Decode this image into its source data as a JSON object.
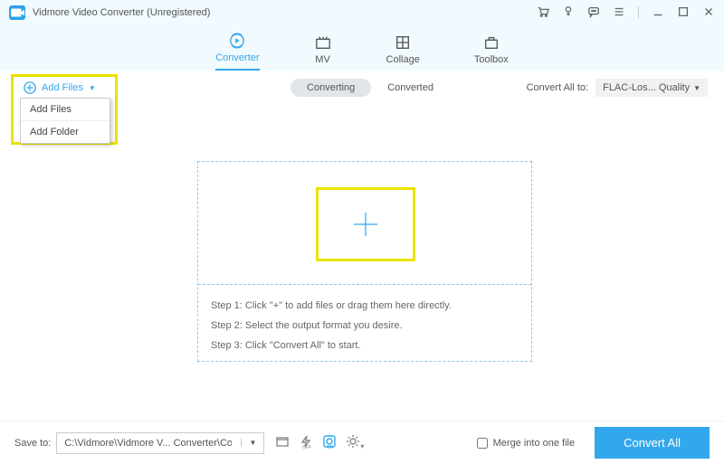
{
  "titlebar": {
    "title": "Vidmore Video Converter (Unregistered)"
  },
  "nav": {
    "tabs": [
      {
        "label": "Converter",
        "active": true
      },
      {
        "label": "MV"
      },
      {
        "label": "Collage"
      },
      {
        "label": "Toolbox"
      }
    ]
  },
  "subbar": {
    "add_files_label": "Add Files",
    "dropdown": [
      {
        "label": "Add Files"
      },
      {
        "label": "Add Folder"
      }
    ],
    "converting_label": "Converting",
    "converted_label": "Converted",
    "convert_all_label": "Convert All to:",
    "format_selected": "FLAC-Los... Quality"
  },
  "dropzone": {
    "step1": "Step 1: Click \"+\" to add files or drag them here directly.",
    "step2": "Step 2: Select the output format you desire.",
    "step3": "Step 3: Click \"Convert All\" to start."
  },
  "bottom": {
    "save_to_label": "Save to:",
    "save_path": "C:\\Vidmore\\Vidmore V... Converter\\Converted",
    "merge_label": "Merge into one file",
    "convert_all_btn": "Convert All"
  }
}
